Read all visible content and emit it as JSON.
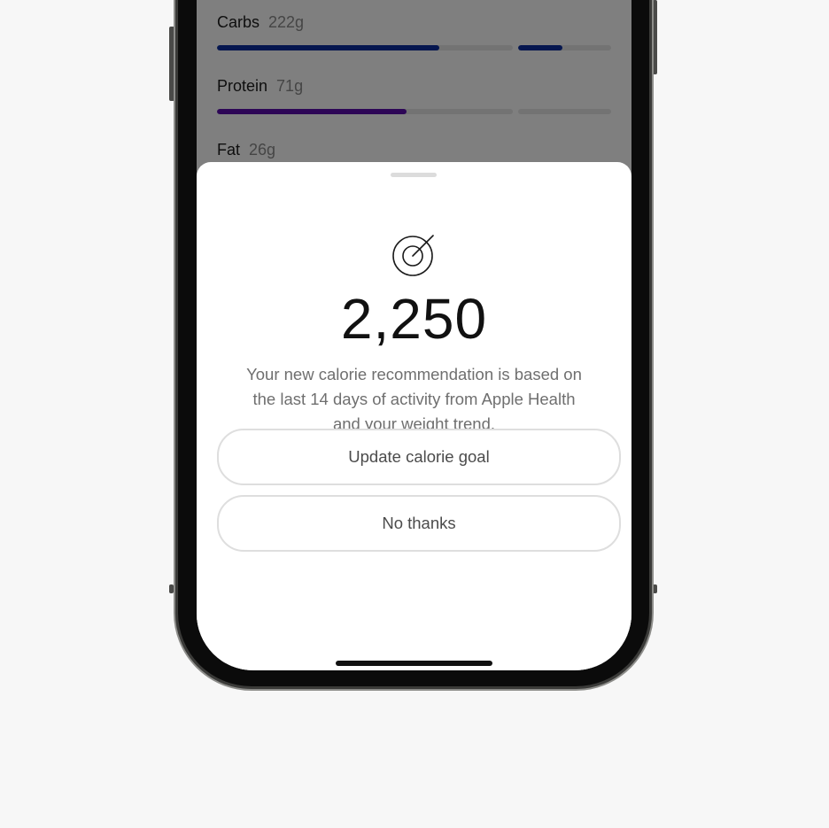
{
  "background_app": {
    "macros": [
      {
        "label": "Carbs",
        "amount": "222g",
        "progress": 0.75,
        "bonus_progress": 0.48,
        "color": "#0b2d9e"
      },
      {
        "label": "Protein",
        "amount": "71g",
        "progress": 0.64,
        "bonus_progress": 0.0,
        "color": "#5b0cad"
      },
      {
        "label": "Fat",
        "amount": "26g",
        "progress": 0.0,
        "bonus_progress": 0.0,
        "color": "#c95a1a"
      }
    ]
  },
  "sheet": {
    "icon": "target-icon",
    "calorie_value": "2,250",
    "description": "Your new calorie recommendation is based on the last 14 days of activity from Apple Health and your weight trend.",
    "primary_button": "Update calorie goal",
    "secondary_button": "No thanks"
  },
  "colors": {
    "overlay": "rgba(0,0,0,0.5)",
    "button_border": "#dedede",
    "text_primary": "#111111",
    "text_secondary": "#6f6f6f"
  }
}
